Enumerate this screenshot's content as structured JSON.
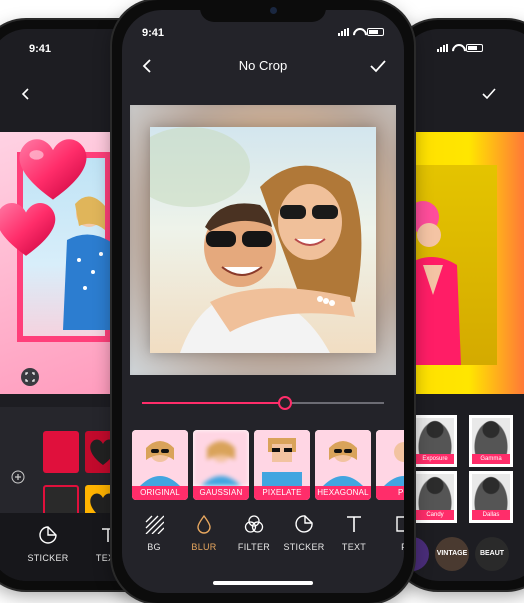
{
  "status": {
    "time": "9:41"
  },
  "center": {
    "title": "No Crop",
    "slider": {
      "value": 0.59
    },
    "effects": [
      {
        "label": "ORIGINAL"
      },
      {
        "label": "GAUSSIAN"
      },
      {
        "label": "PIXELATE"
      },
      {
        "label": "HEXAGONAL"
      },
      {
        "label": "PO"
      }
    ],
    "tools": [
      {
        "label": "BG",
        "icon": "texture-icon"
      },
      {
        "label": "BLUR",
        "icon": "drop-icon",
        "active": true
      },
      {
        "label": "FILTER",
        "icon": "filter-circles-icon"
      },
      {
        "label": "STICKER",
        "icon": "sticker-icon"
      },
      {
        "label": "TEXT",
        "icon": "text-icon"
      },
      {
        "label": "F",
        "icon": "frame-icon"
      }
    ]
  },
  "left": {
    "tools": [
      {
        "label": "STICKER"
      },
      {
        "label": "TEXT"
      }
    ]
  },
  "right": {
    "effects": [
      {
        "label": "Exposure"
      },
      {
        "label": "Gamma"
      },
      {
        "label": "Candy"
      },
      {
        "label": "Dallas"
      }
    ],
    "round_effects": [
      {
        "label": "VINTAGE"
      },
      {
        "label": "BEAUT"
      }
    ]
  },
  "colors": {
    "accent": "#ff2d6a",
    "active": "#e7a75f",
    "screen": "#232329"
  }
}
